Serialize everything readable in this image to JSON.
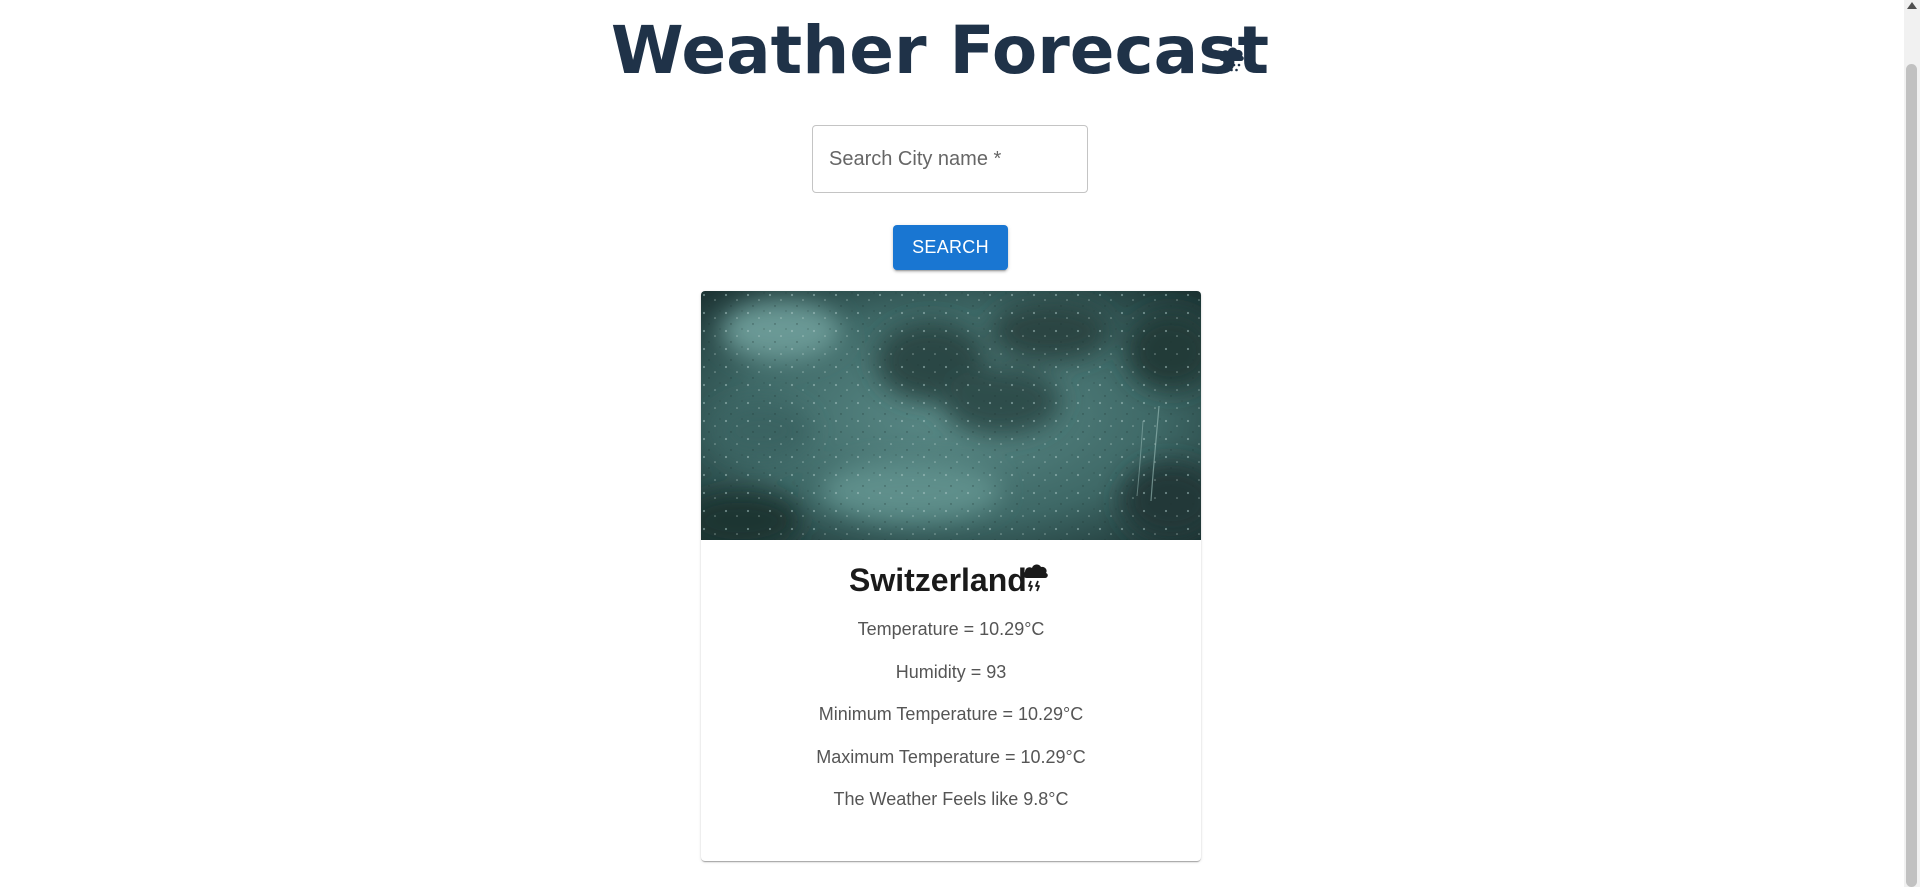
{
  "header": {
    "title": "Weather Forecast",
    "title_icon": "rain-cloud-icon"
  },
  "search": {
    "placeholder": "Search City name *",
    "value": "",
    "button_label": "SEARCH"
  },
  "card": {
    "image_description": "rain-on-window-image",
    "city": "Switzerland",
    "condition_icon": "thunderstorm-cloud-icon",
    "temperature": "Temperature = 10.29°C",
    "humidity": "Humidity = 93",
    "min_temperature": "Minimum Temperature = 10.29°C",
    "max_temperature": "Maximum Temperature = 10.29°C",
    "feels_like": "The Weather Feels like 9.8°C"
  },
  "colors": {
    "title": "#1f3248",
    "button": "#1976d2",
    "image_tint": "#4a7a78"
  }
}
